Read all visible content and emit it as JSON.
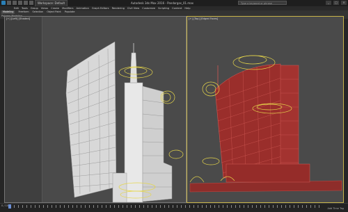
{
  "window": {
    "title": "Autodesk 3ds Max 2016 - Pandorgas_01.max",
    "workspace": "Workspace: Default",
    "search_placeholder": "Type a keyword or phrase",
    "controls": [
      "_",
      "□",
      "×"
    ]
  },
  "menu": {
    "items": [
      "Edit",
      "Tools",
      "Group",
      "Views",
      "Create",
      "Modifiers",
      "Animation",
      "Graph Editors",
      "Rendering",
      "Civil View",
      "Customize",
      "Scripting",
      "Content",
      "Help"
    ]
  },
  "ribbon": {
    "tabs": [
      "Modeling",
      "Freeform",
      "Selection",
      "Object Paint",
      "Populate"
    ],
    "active_tab": "Modeling",
    "panel_label": "Polygon Modeling"
  },
  "viewports": {
    "left_label": "[+] [Left] [Shaded]",
    "right_label": "[+] [Top] [Edged Faces]"
  },
  "statusbar": {
    "frame": "0 / 100",
    "right_text": "Add Time Tag"
  },
  "colors": {
    "viewport_bg": "#4a4a4a",
    "active_border": "#c9b54a",
    "wire_red": "#a4302d",
    "tree_yellow": "#e6d64a"
  }
}
